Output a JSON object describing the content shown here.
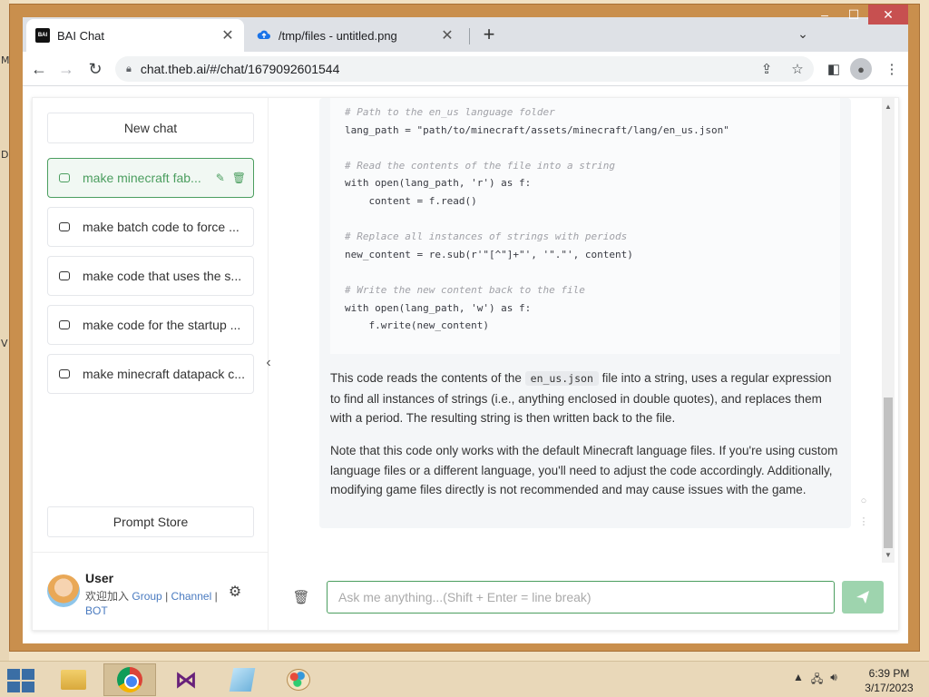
{
  "desktop": {
    "edge_letters": [
      "M",
      "D",
      "V"
    ]
  },
  "browser": {
    "tabs": [
      {
        "title": "BAI Chat",
        "favicon": "BAI",
        "active": true
      },
      {
        "title": "/tmp/files - untitled.png",
        "active": false
      }
    ],
    "url": "chat.theb.ai/#/chat/1679092601544"
  },
  "sidebar": {
    "new_chat_label": "New chat",
    "conversations": [
      {
        "label": "make minecraft fab...",
        "active": true
      },
      {
        "label": "make batch code to force ...",
        "active": false
      },
      {
        "label": "make code that uses the s...",
        "active": false
      },
      {
        "label": "make code for the startup ...",
        "active": false
      },
      {
        "label": "make minecraft datapack c...",
        "active": false
      }
    ],
    "prompt_store_label": "Prompt Store",
    "user": {
      "name": "User",
      "desc_prefix": "欢迎加入",
      "group": "Group",
      "sep1": "|",
      "channel": "Channel",
      "sep2": "|",
      "bot": "BOT"
    }
  },
  "chat": {
    "code_lines": [
      "# Path to the en_us language folder",
      "lang_path = \"path/to/minecraft/assets/minecraft/lang/en_us.json\"",
      "",
      "# Read the contents of the file into a string",
      "with open(lang_path, 'r') as f:",
      "    content = f.read()",
      "",
      "# Replace all instances of strings with periods",
      "new_content = re.sub(r'\"[^\"]+\"', '\".\"', content)",
      "",
      "# Write the new content back to the file",
      "with open(lang_path, 'w') as f:",
      "    f.write(new_content)"
    ],
    "para1_before": "This code reads the contents of the ",
    "para1_code": "en_us.json",
    "para1_after": " file into a string, uses a regular expression to find all instances of strings (i.e., anything enclosed in double quotes), and replaces them with a period. The resulting string is then written back to the file.",
    "para2": "Note that this code only works with the default Minecraft language files. If you're using custom language files or a different language, you'll need to adjust the code accordingly. Additionally, modifying game files directly is not recommended and may cause issues with the game.",
    "input_placeholder": "Ask me anything...(Shift + Enter = line break)"
  },
  "taskbar": {
    "clock_time": "6:39 PM",
    "clock_date": "3/17/2023"
  },
  "colors": {
    "accent": "#4b9e5f",
    "send_button": "#9ed4ae",
    "close_button": "#c75050"
  }
}
